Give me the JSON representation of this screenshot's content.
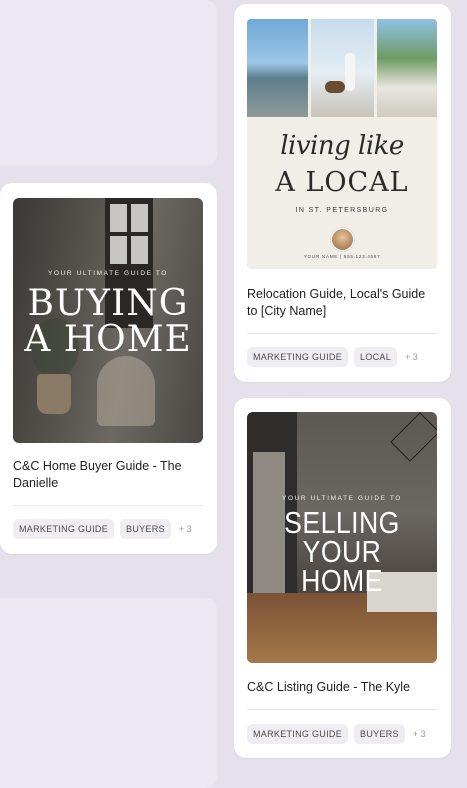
{
  "cards": [
    {
      "title": "Relocation Guide, Local's Guide to [City Name]",
      "cover": {
        "script": "living like",
        "main": "A LOCAL",
        "sub": "IN ST. PETERSBURG",
        "footer": "YOUR NAME | 555.123.4567"
      },
      "tags": [
        "MARKETING GUIDE",
        "LOCAL"
      ],
      "more": "+ 3"
    },
    {
      "title": "C&C Home Buyer Guide - The Danielle",
      "cover": {
        "sub": "YOUR ULTIMATE GUIDE TO",
        "line1": "BUYING",
        "line2": "A HOME"
      },
      "tags": [
        "MARKETING GUIDE",
        "BUYERS"
      ],
      "more": "+ 3"
    },
    {
      "title": "C&C Listing Guide - The Kyle",
      "cover": {
        "sub": "YOUR ULTIMATE GUIDE TO",
        "line1": "SELLING",
        "line2": "YOUR HOME"
      },
      "tags": [
        "MARKETING GUIDE",
        "BUYERS"
      ],
      "more": "+ 3"
    }
  ],
  "colors": {
    "background": "#e6e0ec",
    "card": "#ffffff",
    "tag_bg": "#efedf1"
  }
}
